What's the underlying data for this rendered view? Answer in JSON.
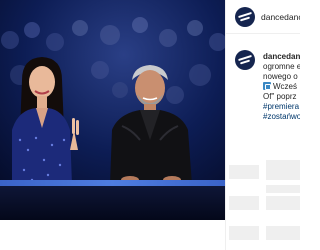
{
  "account": {
    "username": "dancedanc",
    "avatar_color": "#15254f"
  },
  "caption": {
    "username": "dancedan",
    "lines": [
      "ogromne e",
      "nowego o",
      "Wcześ",
      "Of\" poprz"
    ],
    "emoji_name": "calendar-emoji",
    "hashtags": [
      "#premiera",
      "#zostańwo"
    ]
  },
  "colors": {
    "stage_background": "#07123a",
    "link": "#00376b",
    "text": "#262626",
    "placeholder": "#efefef"
  }
}
